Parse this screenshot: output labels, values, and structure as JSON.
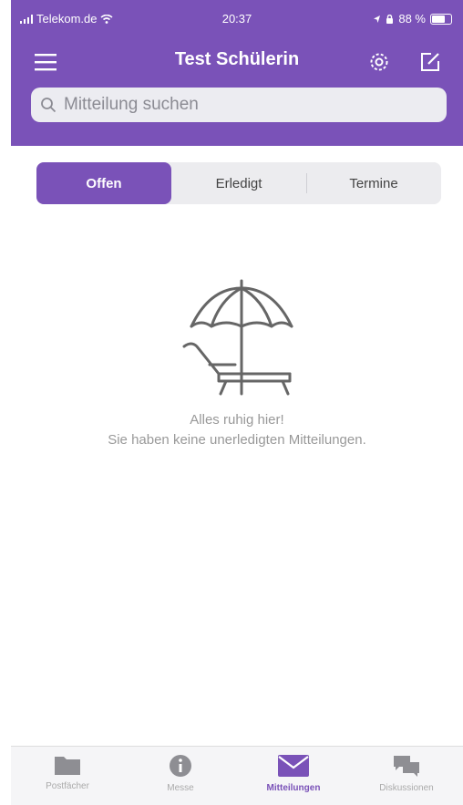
{
  "status": {
    "carrier": "Telekom.de",
    "time": "20:37",
    "battery": "88 %"
  },
  "header": {
    "title": "Test Schülerin"
  },
  "search": {
    "placeholder": "Mitteilung suchen"
  },
  "segments": [
    {
      "label": "Offen",
      "active": true
    },
    {
      "label": "Erledigt",
      "active": false
    },
    {
      "label": "Termine",
      "active": false
    }
  ],
  "empty": {
    "title": "Alles ruhig hier!",
    "subtitle": "Sie haben keine unerledigten Mitteilungen."
  },
  "tabs": [
    {
      "label": "Postfächer",
      "icon": "folder-icon",
      "active": false
    },
    {
      "label": "Messe",
      "icon": "info-icon",
      "active": false
    },
    {
      "label": "Mitteilungen",
      "icon": "envelope-icon",
      "active": true
    },
    {
      "label": "Diskussionen",
      "icon": "chat-icon",
      "active": false
    }
  ],
  "colors": {
    "brand": "#7a52b8",
    "search_bg": "#ececf1"
  }
}
